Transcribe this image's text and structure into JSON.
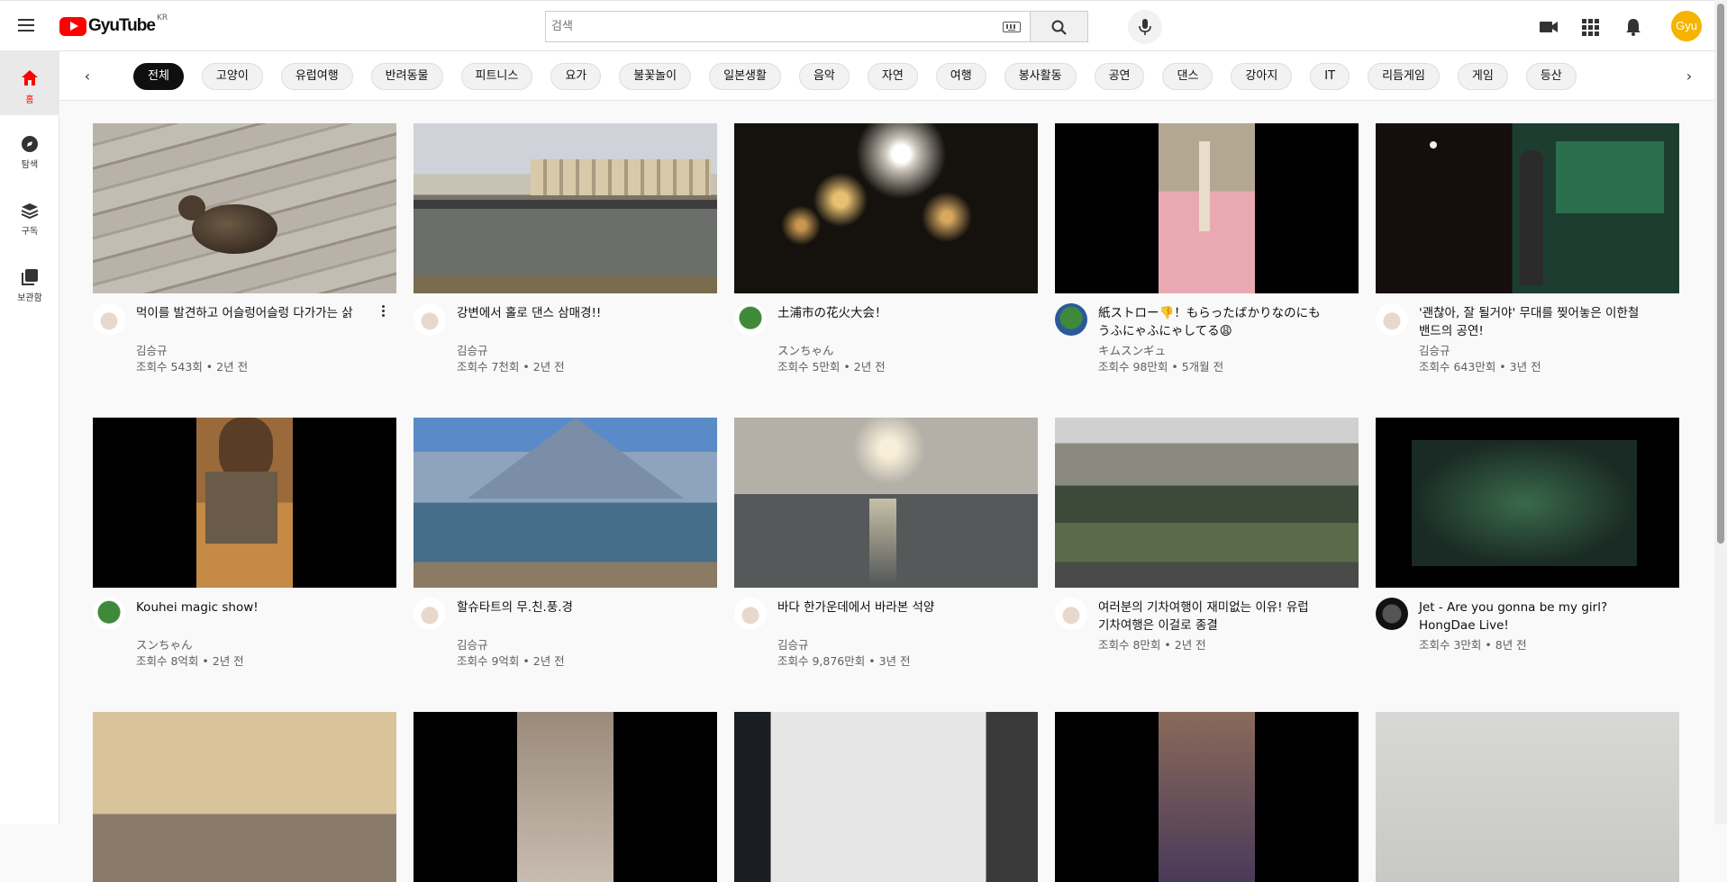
{
  "header": {
    "logo_text": "GyuTube",
    "logo_region": "KR",
    "search_placeholder": "검색",
    "avatar_label": "Gyu"
  },
  "sidebar": {
    "items": [
      {
        "label": "홈",
        "icon": "home-icon"
      },
      {
        "label": "탐색",
        "icon": "compass-icon"
      },
      {
        "label": "구독",
        "icon": "subscriptions-icon"
      },
      {
        "label": "보관함",
        "icon": "library-icon"
      }
    ]
  },
  "chips": [
    "전체",
    "고양이",
    "유럽여행",
    "반려동물",
    "피트니스",
    "요가",
    "불꽃놀이",
    "일본생활",
    "음악",
    "자연",
    "여행",
    "봉사활동",
    "공연",
    "댄스",
    "강아지",
    "IT",
    "리듬게임",
    "게임",
    "등산"
  ],
  "videos": [
    {
      "title": "먹이를 발견하고 어슬렁어슬렁 다가가는 삵",
      "channel": "김승규",
      "stats": "조회수 543회 • 2년 전"
    },
    {
      "title": "강변에서 홀로 댄스 삼매경!!",
      "channel": "김승규",
      "stats": "조회수 7천회 • 2년 전"
    },
    {
      "title": "土浦市の花火大会！",
      "channel": "スンちゃん",
      "stats": "조회수 5만회 • 2년 전"
    },
    {
      "title": "紙ストロー👎！もらったばかりなのにもうふにゃふにゃしてる😩",
      "channel": "キムスンギュ",
      "stats": "조회수 98만회 • 5개월 전"
    },
    {
      "title": "'괜찮아, 잘 될거야' 무대를 찢어놓은 이한철밴드의 공연!",
      "channel": "김승규",
      "stats": "조회수 643만회 • 3년 전"
    },
    {
      "title": "Kouhei magic show!",
      "channel": "スンちゃん",
      "stats": "조회수 8억회 • 2년 전"
    },
    {
      "title": "할슈타트의 무.친.풍.경",
      "channel": "김승규",
      "stats": "조회수 9억회 • 2년 전"
    },
    {
      "title": "바다 한가운데에서 바라본 석양",
      "channel": "김승규",
      "stats": "조회수 9,876만회 • 3년 전"
    },
    {
      "title": "여러분의 기차여행이 재미없는 이유! 유럽 기차여행은 이걸로 종결",
      "channel": "",
      "stats": "조회수 8만회 • 2년 전"
    },
    {
      "title": "Jet - Are you gonna be my girl? HongDae Live!",
      "channel": "",
      "stats": "조회수 3만회 • 8년 전"
    }
  ],
  "colors": {
    "brand_red": "#ff0000",
    "avatar_yellow": "#f4b400",
    "selected_chip": "#0f0f0f"
  }
}
